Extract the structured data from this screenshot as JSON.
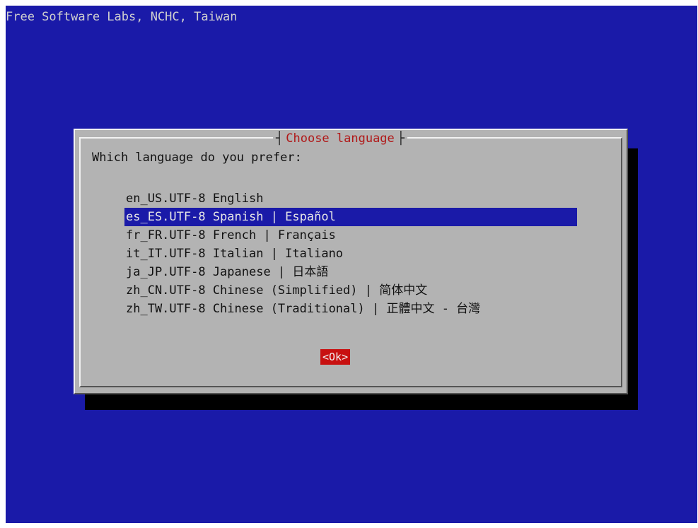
{
  "backtitle": "Free Software Labs, NCHC, Taiwan",
  "dialog": {
    "title": "Choose language",
    "prompt": "Which language do you prefer:",
    "items": [
      {
        "label": "en_US.UTF-8 English"
      },
      {
        "label": "es_ES.UTF-8 Spanish | Español"
      },
      {
        "label": "fr_FR.UTF-8 French | Français"
      },
      {
        "label": "it_IT.UTF-8 Italian | Italiano"
      },
      {
        "label": "ja_JP.UTF-8 Japanese | 日本語"
      },
      {
        "label": "zh_CN.UTF-8 Chinese (Simplified) | 简体中文"
      },
      {
        "label": "zh_TW.UTF-8 Chinese (Traditional) | 正體中文 - 台灣"
      }
    ],
    "selected_index": 1,
    "ok_label": "<Ok>"
  },
  "colors": {
    "background": "#1a1aa8",
    "dialog": "#b3b3b3",
    "title": "#b01818",
    "selection": "#1a1aa8",
    "button": "#c81010"
  }
}
